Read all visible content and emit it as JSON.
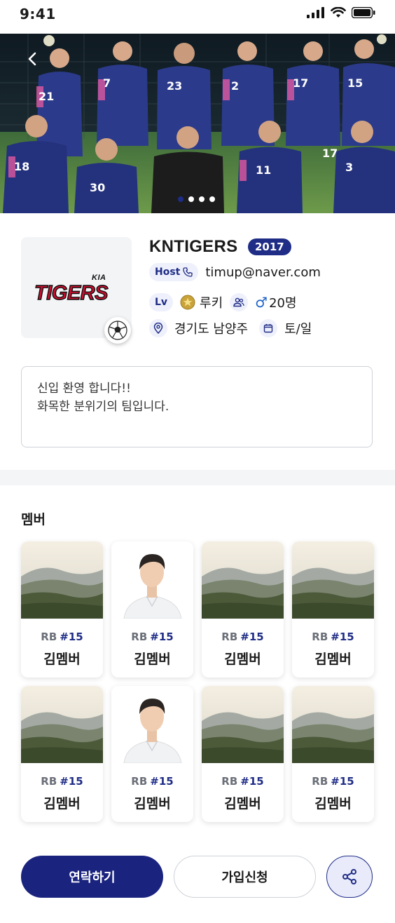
{
  "status_bar": {
    "time": "9:41"
  },
  "hero": {
    "slide_count": 4,
    "active_slide": 0
  },
  "team": {
    "name": "KNTIGERS",
    "year": "2017",
    "logo_text": "TIGERS",
    "logo_brand": "KIA",
    "host_label": "Host",
    "host_email": "timup@naver.com",
    "level_label": "Lv",
    "level_value": "루키",
    "gender_symbol": "♂",
    "member_count": "20명",
    "location": "경기도 남양주",
    "days": "토/일",
    "description_line1": "신입 환영 합니다!!",
    "description_line2": "화목한 분위기의 팀입니다."
  },
  "members_section": {
    "title": "멤버",
    "members": [
      {
        "position": "RB",
        "number": "#15",
        "name": "김멤버",
        "photo": "landscape"
      },
      {
        "position": "RB",
        "number": "#15",
        "name": "김멤버",
        "photo": "portrait"
      },
      {
        "position": "RB",
        "number": "#15",
        "name": "김멤버",
        "photo": "landscape"
      },
      {
        "position": "RB",
        "number": "#15",
        "name": "김멤버",
        "photo": "landscape"
      },
      {
        "position": "RB",
        "number": "#15",
        "name": "김멤버",
        "photo": "landscape"
      },
      {
        "position": "RB",
        "number": "#15",
        "name": "김멤버",
        "photo": "portrait"
      },
      {
        "position": "RB",
        "number": "#15",
        "name": "김멤버",
        "photo": "landscape"
      },
      {
        "position": "RB",
        "number": "#15",
        "name": "김멤버",
        "photo": "landscape"
      }
    ]
  },
  "actions": {
    "contact_label": "연락하기",
    "join_label": "가입신청",
    "share_icon": "share-icon"
  },
  "colors": {
    "primary": "#1a237e",
    "badge": "#1f2d86",
    "pill_bg": "#eef0fb"
  }
}
